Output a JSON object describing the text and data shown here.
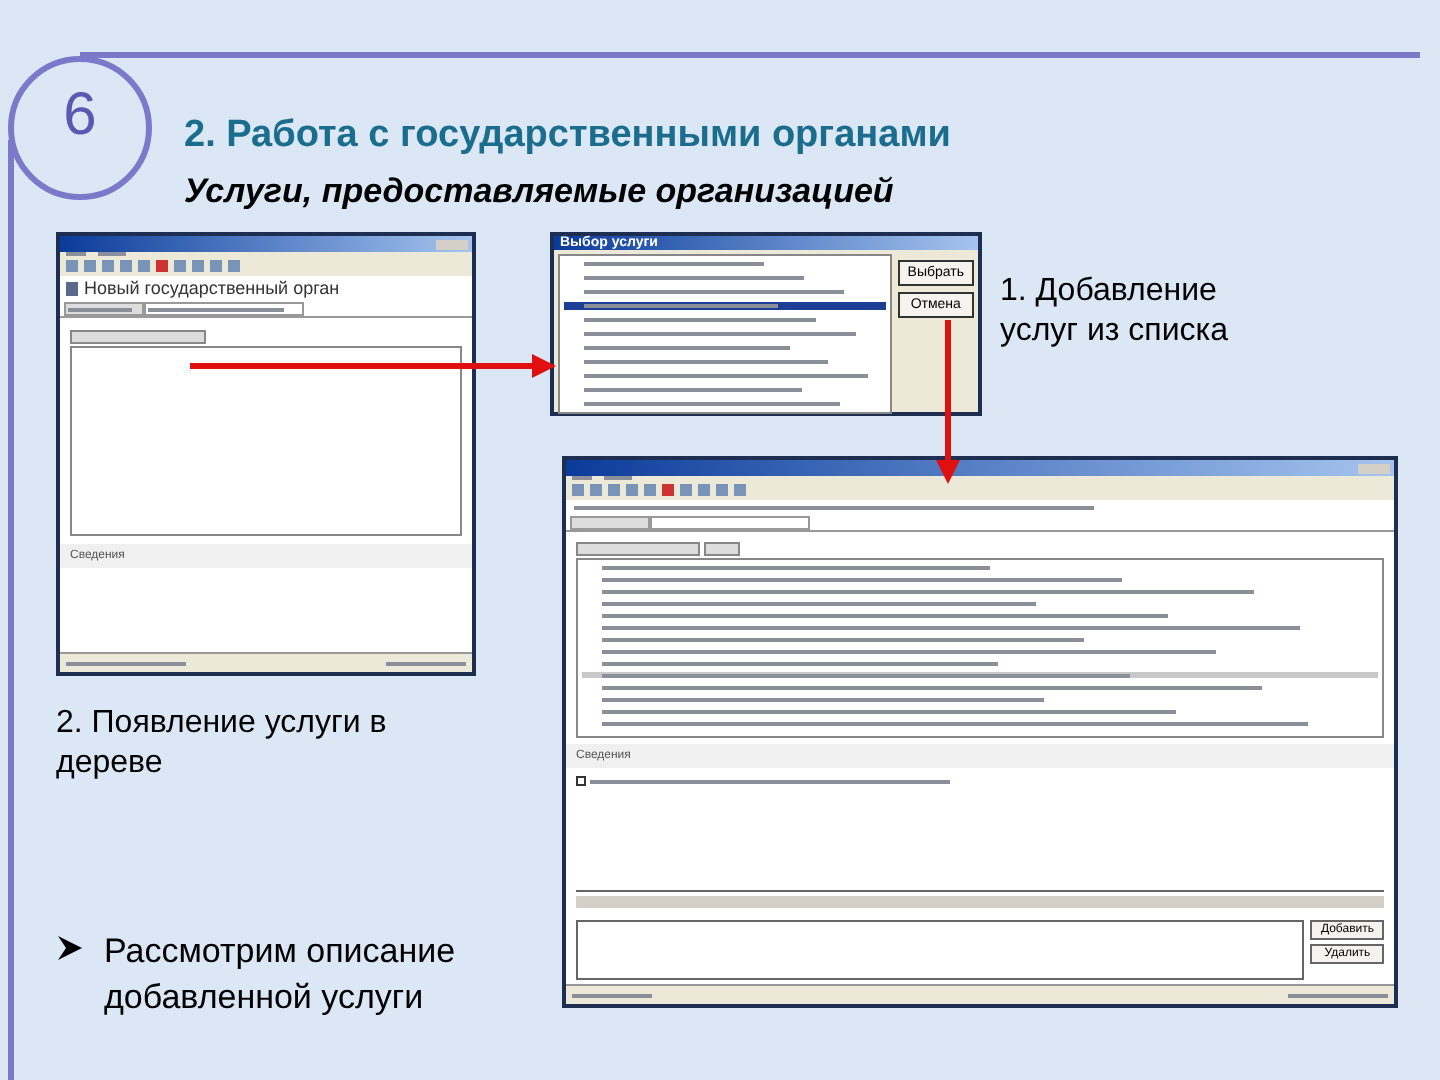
{
  "slide": {
    "number": "6",
    "title": "2. Работа с государственными органами",
    "subtitle": "Услуги, предоставляемые организацией"
  },
  "left_window": {
    "heading": "Новый государственный орган",
    "section": "Сведения"
  },
  "dialog": {
    "title": "Выбор услуги",
    "buttons": [
      "Выбрать",
      "Отмена"
    ],
    "rows": [
      {
        "selected": false
      },
      {
        "selected": false
      },
      {
        "selected": false
      },
      {
        "selected": true
      },
      {
        "selected": false
      },
      {
        "selected": false
      },
      {
        "selected": false
      },
      {
        "selected": false
      },
      {
        "selected": false
      },
      {
        "selected": false
      },
      {
        "selected": false
      }
    ]
  },
  "big_window": {
    "section": "Сведения",
    "checkbox_checked": false,
    "buttons": [
      "Добавить",
      "Удалить"
    ],
    "rows": [
      {
        "selected": false
      },
      {
        "selected": false
      },
      {
        "selected": false
      },
      {
        "selected": false
      },
      {
        "selected": false
      },
      {
        "selected": false
      },
      {
        "selected": false
      },
      {
        "selected": false
      },
      {
        "selected": false
      },
      {
        "selected": true
      },
      {
        "selected": false
      },
      {
        "selected": false
      },
      {
        "selected": false
      },
      {
        "selected": false
      }
    ]
  },
  "captions": [
    "1. Добавление услуг из списка",
    "2. Появление услуги в дереве"
  ],
  "bullet": {
    "text": "Рассмотрим описание добавленной услуги"
  }
}
